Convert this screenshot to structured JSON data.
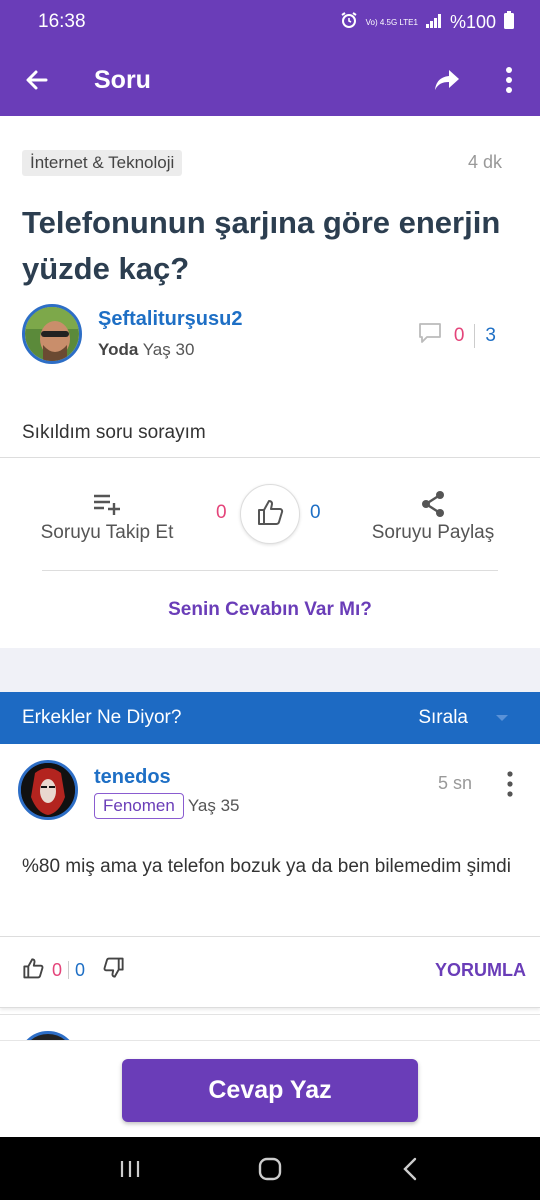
{
  "status_bar": {
    "time": "16:38",
    "network": "Vo) 4.5G LTE1",
    "battery": "%100"
  },
  "app_bar": {
    "title": "Soru",
    "icons": [
      "back-arrow-icon",
      "share-icon",
      "more-vertical-icon"
    ]
  },
  "question": {
    "category": "İnternet & Teknoloji",
    "time_ago": "4 dk",
    "title": "Telefonunun şarjına göre enerjin yüzde kaç?",
    "author": {
      "name": "Şeftaliturşusu2",
      "rank": "Yoda",
      "age": "Yaş 30"
    },
    "comment_count_pink": "0",
    "comment_count_blue": "3",
    "body": "Sıkıldım soru sorayım"
  },
  "actions": {
    "follow_label": "Soruyu Takip Et",
    "share_label": "Soruyu Paylaş",
    "like_pink": "0",
    "like_blue": "0",
    "answer_prompt": "Senin Cevabın Var Mı?"
  },
  "answers_header": {
    "label": "Erkekler Ne Diyor?",
    "sort_label": "Sırala"
  },
  "answer": {
    "author_name": "tenedos",
    "badge": "Fenomen",
    "age": "Yaş 35",
    "time_ago": "5 sn",
    "text": "%80 miş ama ya telefon bozuk ya da ben bilemedim şimdi",
    "like_pink": "0",
    "like_blue": "0",
    "comment_label": "YORUMLA"
  },
  "bottom": {
    "cta_label": "Cevap Yaz"
  },
  "colors": {
    "primary_purple": "#6a3db8",
    "header_blue": "#1d6ac3",
    "link_blue": "#1e6fc5",
    "pink": "#e4447a"
  }
}
